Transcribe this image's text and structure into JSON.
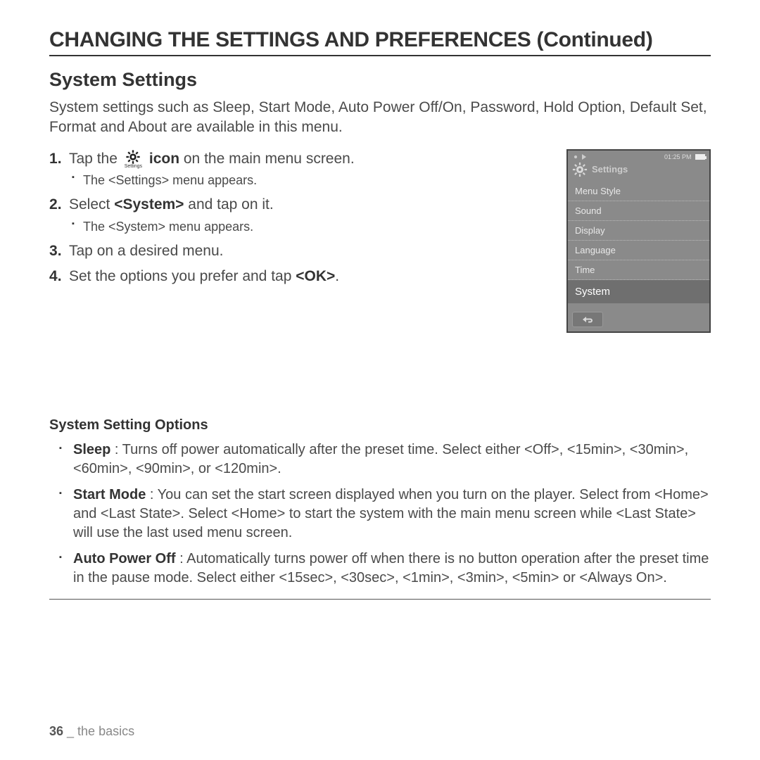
{
  "page_title": "CHANGING THE SETTINGS AND PREFERENCES (Continued)",
  "section_title": "System Settings",
  "intro": "System settings such as Sleep, Start Mode, Auto Power Off/On, Password, Hold Option, Default Set, Format and About are available in this menu.",
  "steps": {
    "s1_a": "Tap the",
    "s1_icon_label": "Settings",
    "s1_b_bold": "icon",
    "s1_c": " on the main menu screen.",
    "s1_sub": "The <Settings> menu appears.",
    "s2_a": "Select ",
    "s2_bold": "<System>",
    "s2_b": " and tap on it.",
    "s2_sub": "The <System> menu appears.",
    "s3": "Tap on a desired menu.",
    "s4_a": "Set the options you prefer and tap ",
    "s4_bold": "<OK>",
    "s4_b": "."
  },
  "device": {
    "time": "01:25 PM",
    "header": "Settings",
    "items": [
      "Menu Style",
      "Sound",
      "Display",
      "Language",
      "Time",
      "System"
    ]
  },
  "options_title": "System Setting Options",
  "options": {
    "o1_l": "Sleep",
    "o1_t": " : Turns off power automatically after the preset time. Select either <Off>, <15min>, <30min>, <60min>, <90min>, or <120min>.",
    "o2_l": "Start Mode",
    "o2_t": " : You can set the start screen displayed when you turn on the player. Select from <Home> and <Last State>. Select <Home> to start the system with the main menu screen while <Last State> will use the last used menu screen.",
    "o3_l": "Auto Power Off",
    "o3_t": " : Automatically turns power off when there is no button operation after the preset time in the pause mode. Select either <15sec>, <30sec>, <1min>, <3min>, <5min> or <Always On>."
  },
  "footer": {
    "page": "36",
    "sep": " _ ",
    "chapter": "the basics"
  }
}
